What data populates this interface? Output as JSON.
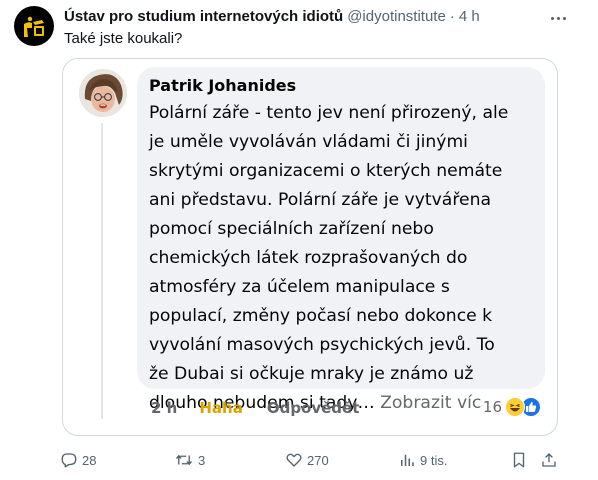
{
  "tweet": {
    "author_name": "Ústav pro studium internetových idiotů",
    "author_handle": "@idyotinstitute",
    "separator": "·",
    "time_ago": "4 h",
    "text": "Také jste koukali?"
  },
  "embedded_comment": {
    "commenter_name": "Patrik Johanides",
    "comment_text": "Polární záře - tento jev není přirozený, ale\nje uměle vyvoláván vládami či jinými\nskrytými organizacemi o kterých nemáte\nani představu. Polární záře je vytvářena\npomocí speciálních zařízení nebo\nchemických látek rozprašovaných do\natmosféry za účelem manipulace s\npopulací, změny počasí nebo dokonce k\nvyvolání masových psychických jevů. To\nže Dubai si očkuje mraky je známo už\ndlouho nebudem si tady…",
    "see_more_label": "Zobrazit víc",
    "time": "2 h",
    "reaction_label": "Haha",
    "reply_label": "Odpovědět",
    "reaction_count": "16",
    "reaction_icons": [
      "haha-emoji-icon",
      "like-thumb-icon"
    ]
  },
  "engagement": {
    "replies": "28",
    "retweets": "3",
    "likes": "270",
    "views": "9 tis."
  },
  "colors": {
    "facebook_blue": "#1b74e4",
    "haha_yellow": "#d9a300",
    "bubble_bg": "#f0f2f5",
    "secondary_text": "#536471"
  }
}
